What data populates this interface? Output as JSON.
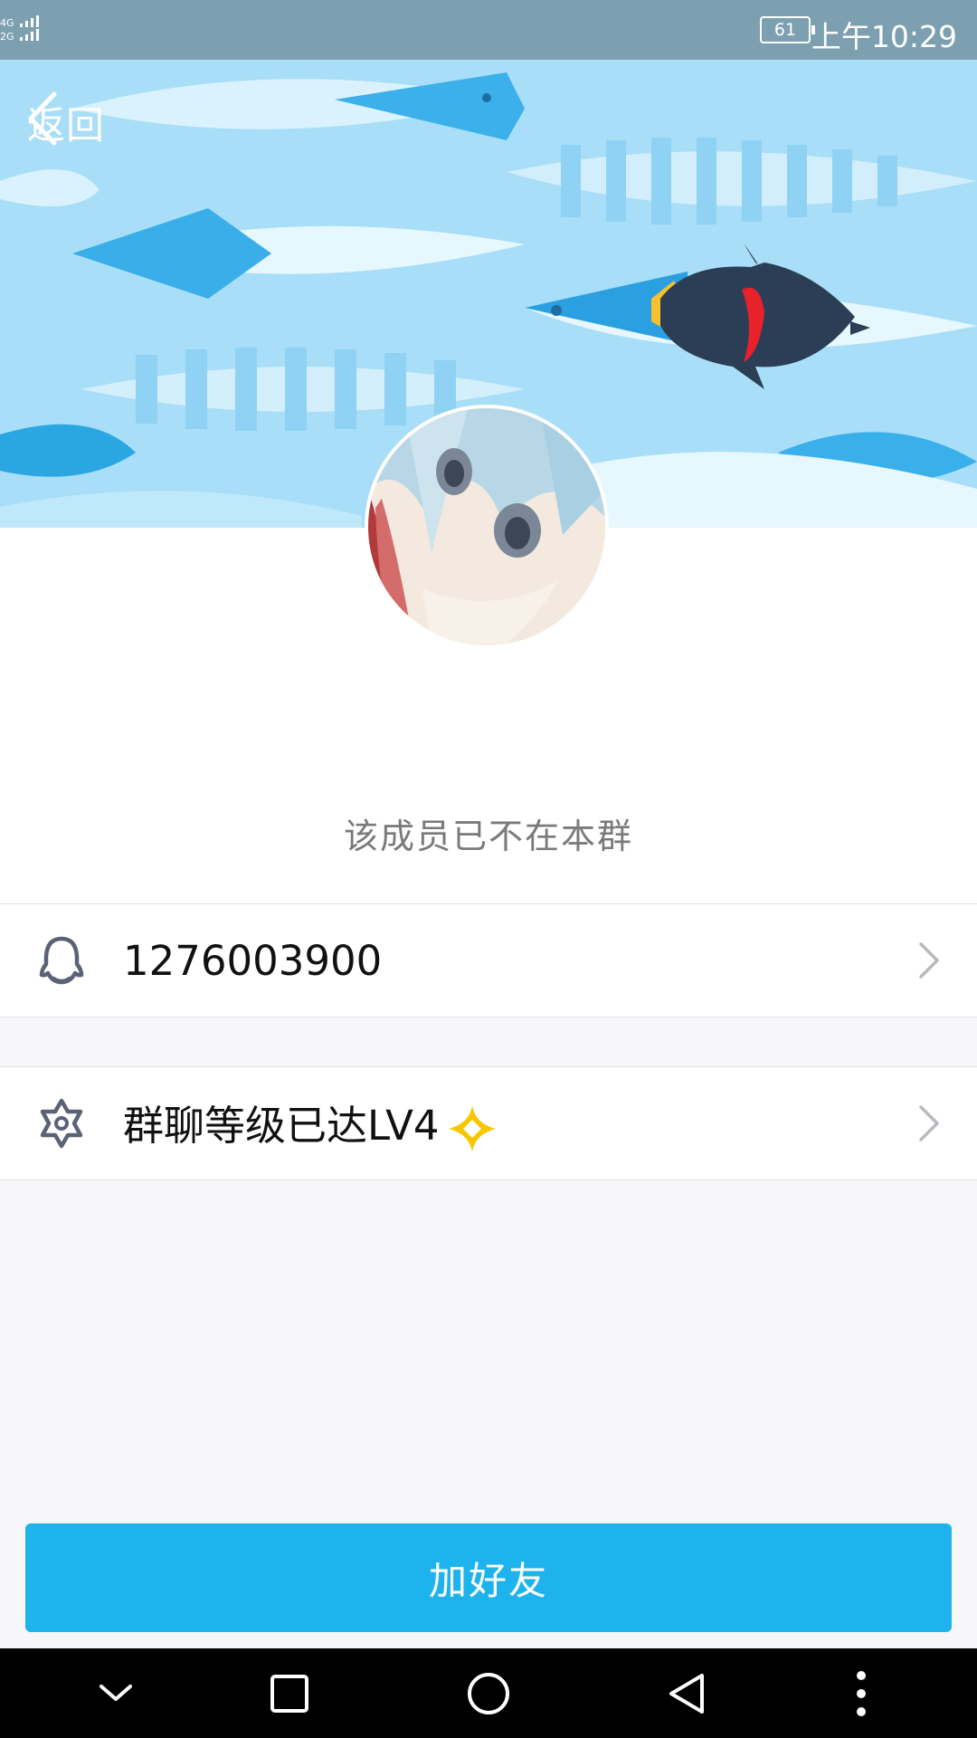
{
  "statusbar": {
    "network": "4G 2G",
    "battery": "61",
    "time": "上午10:29"
  },
  "header": {
    "back_label": "返回"
  },
  "profile": {
    "member_status": "该成员已不在本群"
  },
  "rows": {
    "qq_number": "1276003900",
    "group_level": "群聊等级已达LV4"
  },
  "actions": {
    "add_friend_label": "加好友"
  },
  "colors": {
    "accent": "#1fb3ee",
    "banner_light": "#a9e0f8",
    "banner_fish": "#2aa8e6",
    "level_diamond": "#f7c600"
  },
  "icons": {
    "back": "chevron-left-icon",
    "qq": "qq-penguin-icon",
    "level": "star-badge-icon",
    "diamond": "diamond-icon",
    "row_arrow": "chevron-right-icon",
    "nav": [
      "chevron-down-icon",
      "square-icon",
      "circle-icon",
      "triangle-back-icon",
      "more-vertical-icon"
    ]
  }
}
